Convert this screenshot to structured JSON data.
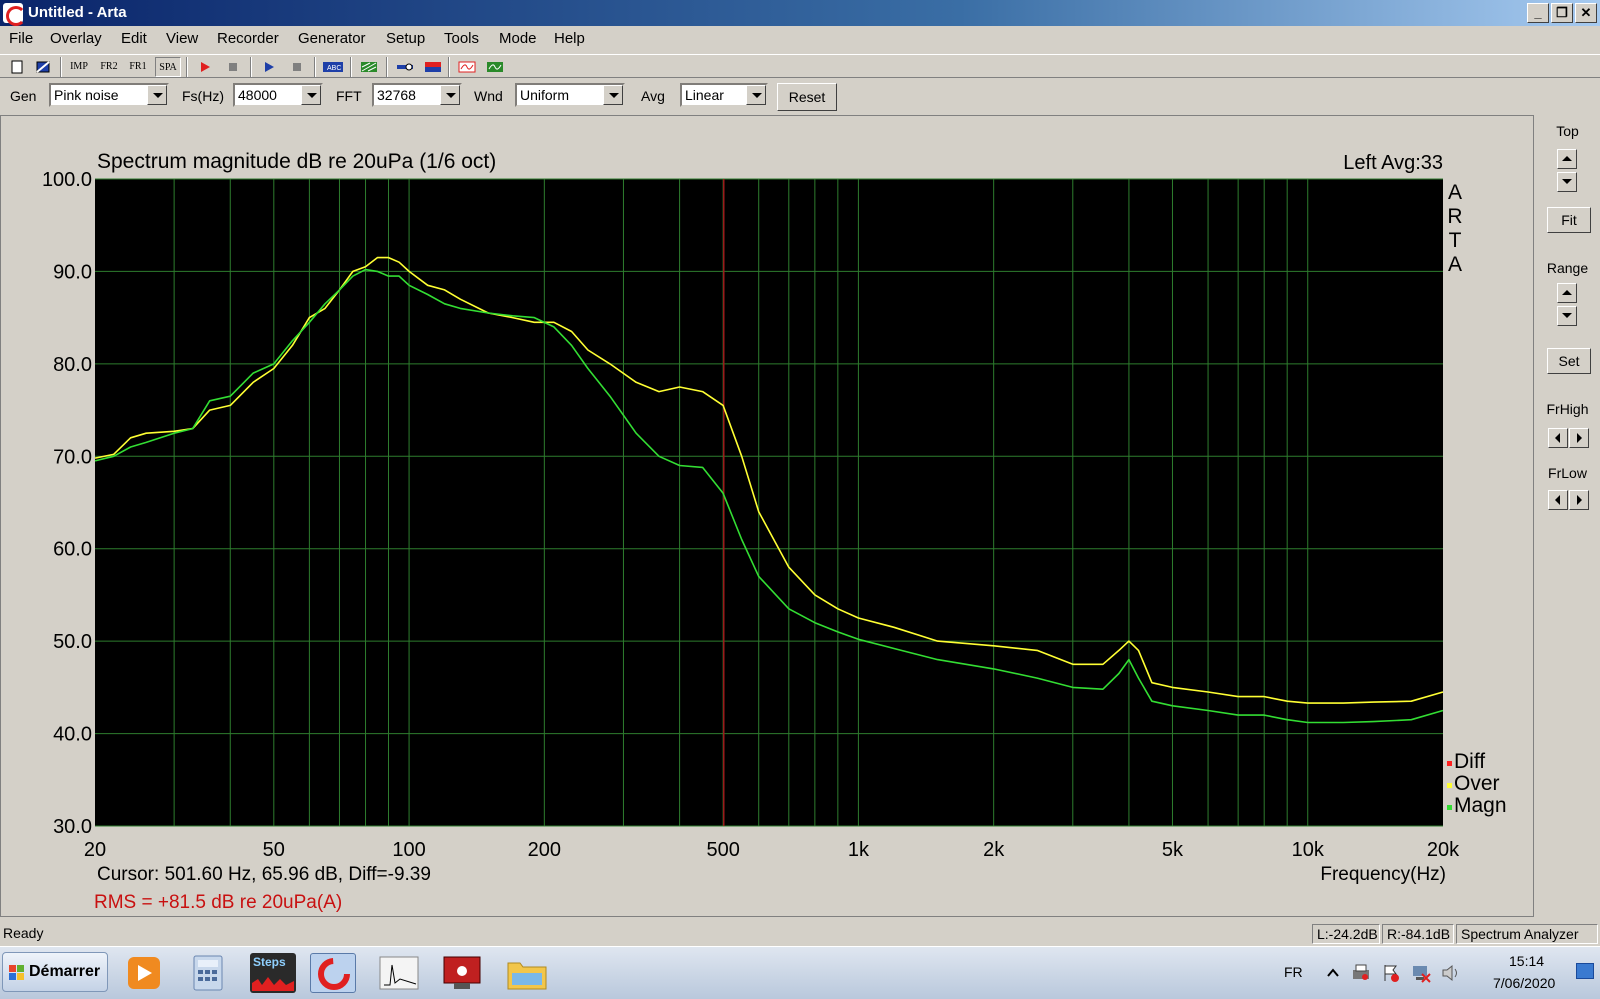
{
  "window": {
    "title": "Untitled - Arta",
    "btn_min": "_",
    "btn_max": "❐",
    "btn_close": "✕"
  },
  "menu": [
    "File",
    "Overlay",
    "Edit",
    "View",
    "Recorder",
    "Generator",
    "Setup",
    "Tools",
    "Mode",
    "Help"
  ],
  "toolbar": {
    "buttons": [
      "new-icon",
      "open-icon",
      "Imp",
      "Fr2",
      "Fr1",
      "Spa",
      "record-icon",
      "stop-icon",
      "play-icon",
      "stop-icon",
      "abc-icon",
      "grid-icon",
      "meter-icon",
      "spectrum-icon",
      "scope-icon",
      "wave-icon"
    ],
    "labels": {
      "imp": "IMP",
      "fr2": "FR2",
      "fr1": "FR1",
      "spa": "SPA"
    }
  },
  "controls": {
    "gen_label": "Gen",
    "gen_value": "Pink noise",
    "fs_label": "Fs(Hz)",
    "fs_value": "48000",
    "fft_label": "FFT",
    "fft_value": "32768",
    "wnd_label": "Wnd",
    "wnd_value": "Uniform",
    "avg_label": "Avg",
    "avg_value": "Linear",
    "reset_label": "Reset"
  },
  "right_panel": {
    "top_label": "Top",
    "fit_label": "Fit",
    "range_label": "Range",
    "set_label": "Set",
    "frhigh_label": "FrHigh",
    "frlow_label": "FrLow"
  },
  "status": {
    "ready": "Ready",
    "l_level": "L:-24.2dB",
    "r_level": "R:-84.1dB",
    "mode": "Spectrum Analyzer"
  },
  "taskbar": {
    "start_label": "Démarrer",
    "steps_label": "Steps",
    "lang": "FR",
    "time": "15:14",
    "date": "7/06/2020"
  },
  "colors": {
    "yellow": "#ffff33",
    "green": "#33dd33",
    "red": "#ff2020",
    "grid": "#2e7d2e",
    "cursor": "#9b1c1c"
  },
  "chart_data": {
    "type": "line",
    "title": "Spectrum magnitude dB re 20uPa (1/6 oct)",
    "channel_info": "Left  Avg:33",
    "watermark": [
      "A",
      "R",
      "T",
      "A"
    ],
    "xlabel": "Frequency(Hz)",
    "x_scale": "log",
    "xlim": [
      20,
      20000
    ],
    "ylim": [
      30,
      100
    ],
    "x_ticks": [
      20,
      50,
      100,
      200,
      500,
      1000,
      2000,
      5000,
      10000,
      20000
    ],
    "x_tick_labels": [
      "20",
      "50",
      "100",
      "200",
      "500",
      "1k",
      "2k",
      "5k",
      "10k",
      "20k"
    ],
    "y_ticks": [
      30,
      40,
      50,
      60,
      70,
      80,
      90,
      100
    ],
    "y_tick_labels": [
      "30.0",
      "40.0",
      "50.0",
      "60.0",
      "70.0",
      "80.0",
      "90.0",
      "100.0"
    ],
    "grid": true,
    "cursor_x": 501.6,
    "cursor_text": "Cursor:   501.60 Hz, 65.96 dB,  Diff=-9.39",
    "rms_text": "RMS =  +81.5 dB re 20uPa(A)",
    "legend_position": "bottom-right",
    "legend": [
      {
        "name": "Diff",
        "color": "#ff2020"
      },
      {
        "name": "Over",
        "color": "#ffff33"
      },
      {
        "name": "Magn",
        "color": "#33dd33"
      }
    ],
    "series": [
      {
        "name": "Over",
        "color": "#ffff33",
        "points": [
          [
            20,
            69.8
          ],
          [
            22,
            70.2
          ],
          [
            24,
            72.0
          ],
          [
            26,
            72.5
          ],
          [
            30,
            72.7
          ],
          [
            33,
            73.0
          ],
          [
            36,
            75.0
          ],
          [
            40,
            75.5
          ],
          [
            45,
            78.0
          ],
          [
            50,
            79.5
          ],
          [
            55,
            82.0
          ],
          [
            60,
            85.0
          ],
          [
            65,
            86.0
          ],
          [
            70,
            88.0
          ],
          [
            75,
            90.0
          ],
          [
            80,
            90.5
          ],
          [
            85,
            91.5
          ],
          [
            90,
            91.5
          ],
          [
            95,
            91.0
          ],
          [
            100,
            90.0
          ],
          [
            110,
            88.5
          ],
          [
            120,
            88.0
          ],
          [
            130,
            87.0
          ],
          [
            150,
            85.5
          ],
          [
            170,
            85.0
          ],
          [
            190,
            84.5
          ],
          [
            210,
            84.5
          ],
          [
            230,
            83.5
          ],
          [
            250,
            81.5
          ],
          [
            280,
            80.0
          ],
          [
            320,
            78.0
          ],
          [
            360,
            77.0
          ],
          [
            400,
            77.5
          ],
          [
            450,
            77.0
          ],
          [
            500,
            75.5
          ],
          [
            550,
            70.0
          ],
          [
            600,
            64.0
          ],
          [
            700,
            58.0
          ],
          [
            800,
            55.0
          ],
          [
            900,
            53.5
          ],
          [
            1000,
            52.5
          ],
          [
            1200,
            51.5
          ],
          [
            1500,
            50.0
          ],
          [
            2000,
            49.5
          ],
          [
            2500,
            49.0
          ],
          [
            3000,
            47.5
          ],
          [
            3500,
            47.5
          ],
          [
            3800,
            49.0
          ],
          [
            4000,
            50.0
          ],
          [
            4200,
            49.0
          ],
          [
            4500,
            45.5
          ],
          [
            5000,
            45.0
          ],
          [
            6000,
            44.5
          ],
          [
            7000,
            44.0
          ],
          [
            8000,
            44.0
          ],
          [
            9000,
            43.5
          ],
          [
            10000,
            43.3
          ],
          [
            12000,
            43.3
          ],
          [
            14000,
            43.4
          ],
          [
            17000,
            43.5
          ],
          [
            20000,
            44.5
          ]
        ]
      },
      {
        "name": "Magn",
        "color": "#33dd33",
        "points": [
          [
            20,
            69.5
          ],
          [
            22,
            70.0
          ],
          [
            24,
            71.0
          ],
          [
            26,
            71.5
          ],
          [
            30,
            72.5
          ],
          [
            33,
            73.0
          ],
          [
            36,
            76.0
          ],
          [
            40,
            76.5
          ],
          [
            45,
            79.0
          ],
          [
            50,
            80.0
          ],
          [
            55,
            82.5
          ],
          [
            60,
            84.5
          ],
          [
            65,
            86.5
          ],
          [
            70,
            88.0
          ],
          [
            75,
            89.5
          ],
          [
            80,
            90.2
          ],
          [
            85,
            90.0
          ],
          [
            90,
            89.5
          ],
          [
            95,
            89.5
          ],
          [
            100,
            88.5
          ],
          [
            110,
            87.5
          ],
          [
            120,
            86.5
          ],
          [
            130,
            86.0
          ],
          [
            150,
            85.5
          ],
          [
            170,
            85.2
          ],
          [
            190,
            85.0
          ],
          [
            210,
            84.0
          ],
          [
            230,
            82.0
          ],
          [
            250,
            79.5
          ],
          [
            280,
            76.5
          ],
          [
            320,
            72.5
          ],
          [
            360,
            70.0
          ],
          [
            400,
            69.0
          ],
          [
            450,
            68.8
          ],
          [
            500,
            66.0
          ],
          [
            550,
            61.0
          ],
          [
            600,
            57.0
          ],
          [
            700,
            53.5
          ],
          [
            800,
            52.0
          ],
          [
            900,
            51.0
          ],
          [
            1000,
            50.2
          ],
          [
            1200,
            49.2
          ],
          [
            1500,
            48.0
          ],
          [
            2000,
            47.0
          ],
          [
            2500,
            46.0
          ],
          [
            3000,
            45.0
          ],
          [
            3500,
            44.8
          ],
          [
            3800,
            46.5
          ],
          [
            4000,
            48.0
          ],
          [
            4200,
            46.0
          ],
          [
            4500,
            43.5
          ],
          [
            5000,
            43.0
          ],
          [
            6000,
            42.5
          ],
          [
            7000,
            42.0
          ],
          [
            8000,
            42.0
          ],
          [
            9000,
            41.5
          ],
          [
            10000,
            41.2
          ],
          [
            12000,
            41.2
          ],
          [
            14000,
            41.3
          ],
          [
            17000,
            41.5
          ],
          [
            20000,
            42.5
          ]
        ]
      }
    ]
  }
}
